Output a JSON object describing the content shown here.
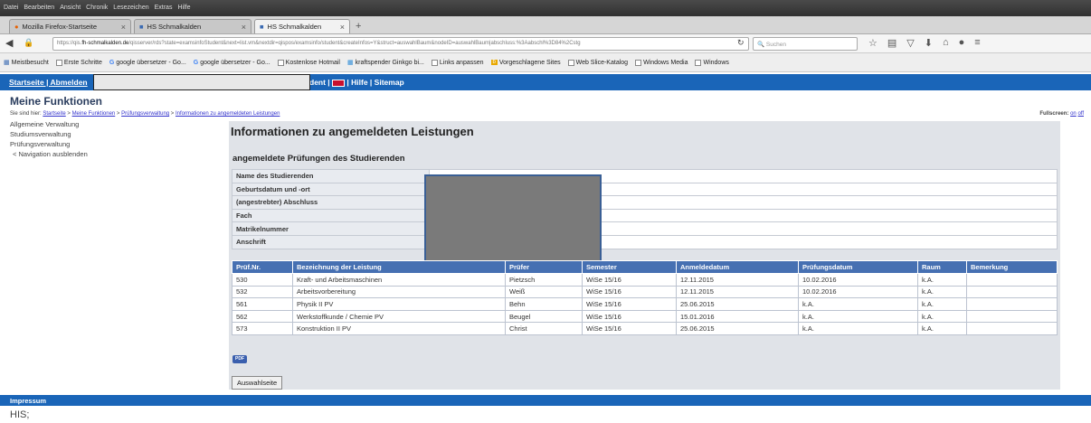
{
  "browser": {
    "menu": [
      "Datei",
      "Bearbeiten",
      "Ansicht",
      "Chronik",
      "Lesezeichen",
      "Extras",
      "Hilfe"
    ],
    "tabs": [
      {
        "label": "Mozilla Firefox-Startseite"
      },
      {
        "label": "HS Schmalkalden"
      },
      {
        "label": "HS Schmalkalden",
        "active": true
      }
    ],
    "url_prefix": "https://qis.",
    "url_host": "fh-schmalkalden.de",
    "url_rest": "/qisserver/rds?state=examsinfoStudent&next=list.vm&nextdir=qispos/examsinfo/student&createInfos=Y&struct=auswahlBaum&nodeID=auswahlBaum|abschluss:%3Aabschl%3D84%2Cstg",
    "search_placeholder": "Suchen",
    "bookmarks": [
      "Meistbesucht",
      "Erste Schritte",
      "google übersetzer - Go...",
      "google übersetzer - Go...",
      "Kostenlose Hotmail",
      "kraftspender Ginkgo bi...",
      "Links anpassen",
      "Vorgeschlagene Sites",
      "Web Slice-Katalog",
      "Windows Media",
      "Windows"
    ]
  },
  "site": {
    "nav_left": "Startseite | ",
    "nav_logout": "Abmelden",
    "nav_right": "dent | ",
    "nav_help": " | Hilfe | Sitemap",
    "heading": "Meine Funktionen",
    "breadcrumb_prefix": "Sie sind hier: ",
    "breadcrumb": [
      "Startseite",
      "Meine Funktionen",
      "Prüfungsverwaltung",
      "Informationen zu angemeldeten Leistungen"
    ],
    "fullscreen_label": "Fullscreen: ",
    "fullscreen_on": "on",
    "fullscreen_off": "off",
    "sidebar": [
      "Allgemeine Verwaltung",
      "Studiumsverwaltung",
      "Prüfungsverwaltung",
      "< Navigation ausblenden"
    ],
    "page_title": "Informationen zu angemeldeten Leistungen",
    "section_title": "angemeldete Prüfungen des Studierenden",
    "info_labels": [
      "Name des Studierenden",
      "Geburtsdatum und -ort",
      "(angestrebter) Abschluss",
      "Fach",
      "Matrikelnummer",
      "Anschrift"
    ],
    "table_headers": [
      "Prüf.Nr.",
      "Bezeichnung der Leistung",
      "Prüfer",
      "Semester",
      "Anmeldedatum",
      "Prüfungsdatum",
      "Raum",
      "Bemerkung"
    ],
    "rows": [
      [
        "530",
        "Kraft- und Arbeitsmaschinen",
        "Pietzsch",
        "WiSe 15/16",
        "12.11.2015",
        "10.02.2016",
        "k.A.",
        ""
      ],
      [
        "532",
        "Arbeitsvorbereitung",
        "Weiß",
        "WiSe 15/16",
        "12.11.2015",
        "10.02.2016",
        "k.A.",
        ""
      ],
      [
        "561",
        "Physik II PV",
        "Behn",
        "WiSe 15/16",
        "25.06.2015",
        "k.A.",
        "k.A.",
        ""
      ],
      [
        "562",
        "Werkstoffkunde / Chemie PV",
        "Beugel",
        "WiSe 15/16",
        "15.01.2016",
        "k.A.",
        "k.A.",
        ""
      ],
      [
        "573",
        "Konstruktion II PV",
        "Christ",
        "WiSe 15/16",
        "25.06.2015",
        "k.A.",
        "k.A.",
        ""
      ]
    ],
    "pdf_label": "PDF",
    "back_button": "Auswahlseite",
    "footer": "Impressum",
    "his": "HIS;"
  }
}
